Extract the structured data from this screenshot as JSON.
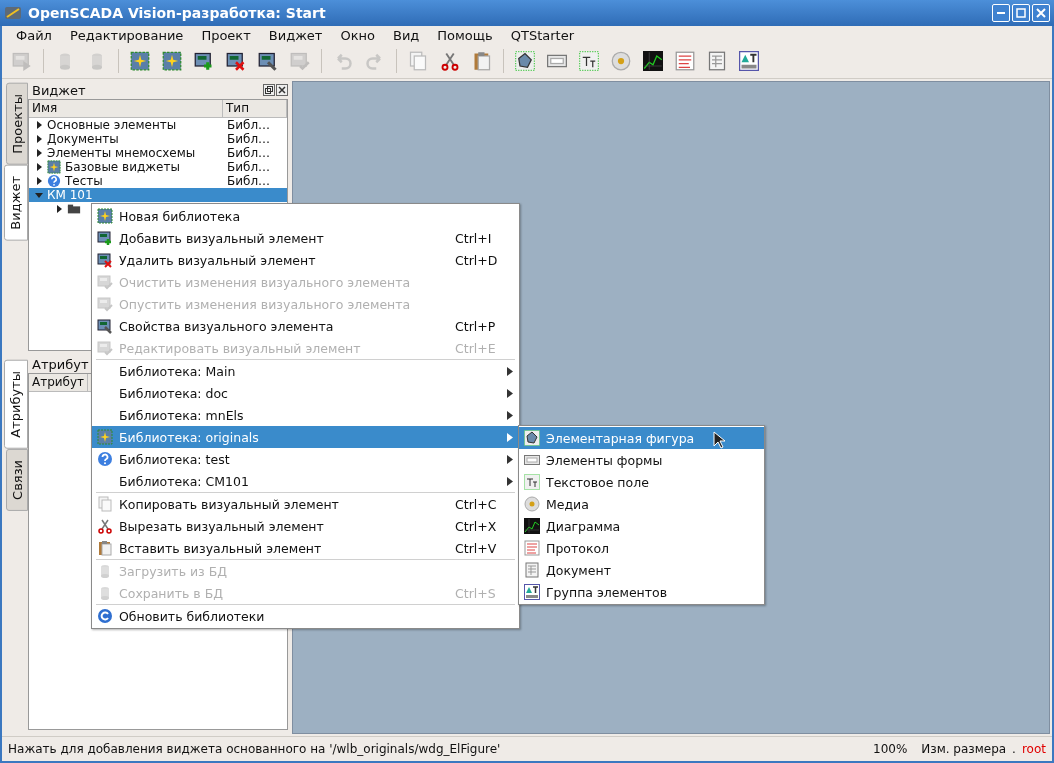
{
  "window": {
    "title": "OpenSCADA Vision-разработка: Start"
  },
  "menu_bar": [
    {
      "label": "Файл"
    },
    {
      "label": "Редактирование"
    },
    {
      "label": "Проект"
    },
    {
      "label": "Виджет"
    },
    {
      "label": "Окно"
    },
    {
      "label": "Вид"
    },
    {
      "label": "Помощь"
    },
    {
      "label": "QTStarter"
    }
  ],
  "toolbar": [
    {
      "kind": "run",
      "disabled": true
    },
    {
      "kind": "separator"
    },
    {
      "kind": "db-load",
      "disabled": true
    },
    {
      "kind": "db-save",
      "disabled": true
    },
    {
      "kind": "separator"
    },
    {
      "kind": "lib",
      "disabled": false
    },
    {
      "kind": "lib-new",
      "disabled": false
    },
    {
      "kind": "add",
      "disabled": false
    },
    {
      "kind": "delete",
      "disabled": false
    },
    {
      "kind": "props",
      "disabled": false
    },
    {
      "kind": "edit",
      "disabled": true
    },
    {
      "kind": "separator"
    },
    {
      "kind": "undo",
      "disabled": true
    },
    {
      "kind": "redo",
      "disabled": true
    },
    {
      "kind": "separator"
    },
    {
      "kind": "copy",
      "disabled": false
    },
    {
      "kind": "cut",
      "disabled": false
    },
    {
      "kind": "paste",
      "disabled": false
    },
    {
      "kind": "separator"
    },
    {
      "kind": "figure",
      "disabled": false
    },
    {
      "kind": "form",
      "disabled": false
    },
    {
      "kind": "text",
      "disabled": false
    },
    {
      "kind": "media",
      "disabled": false
    },
    {
      "kind": "diagram",
      "disabled": false
    },
    {
      "kind": "protocol",
      "disabled": false
    },
    {
      "kind": "document",
      "disabled": false
    },
    {
      "kind": "group",
      "disabled": false
    }
  ],
  "side_tabs_top": [
    {
      "label": "Проекты",
      "selected": false
    },
    {
      "label": "Виджет",
      "selected": true
    }
  ],
  "side_tabs_bottom": [
    {
      "label": "Атрибуты",
      "selected": true
    },
    {
      "label": "Связи",
      "selected": false
    }
  ],
  "widget_dock": {
    "title": "Виджет",
    "columns": [
      "Имя",
      "Тип"
    ],
    "tree": [
      {
        "kind": "plain",
        "name": "Основные элементы",
        "type": "Библ…",
        "expanded": false,
        "selected": false
      },
      {
        "kind": "plain",
        "name": "Документы",
        "type": "Библ…",
        "expanded": false,
        "selected": false
      },
      {
        "kind": "plain",
        "name": "Элементы мнемосхемы",
        "type": "Библ…",
        "expanded": false,
        "selected": false
      },
      {
        "kind": "lib",
        "name": "Базовые виджеты",
        "type": "Библ…",
        "expanded": false,
        "selected": false
      },
      {
        "kind": "question",
        "name": "Тесты",
        "type": "Библ…",
        "expanded": false,
        "selected": false
      },
      {
        "kind": "plain",
        "name": "КМ 101",
        "expanded": true,
        "selected": true,
        "children": [
          {
            "kind": "folder",
            "expanded": false,
            "selected": false
          }
        ]
      }
    ]
  },
  "attributes_dock": {
    "title": "Атрибут",
    "columns": [
      "Атрибут"
    ]
  },
  "context_menu": [
    {
      "kind": "lib-new",
      "label": "Новая библиотека",
      "submenu": false,
      "disabled": false,
      "selected": false
    },
    {
      "kind": "add",
      "label": "Добавить визуальный элемент",
      "shortcut": "Ctrl+I",
      "submenu": false,
      "disabled": false,
      "selected": false
    },
    {
      "kind": "delete",
      "label": "Удалить визуальный элемент",
      "shortcut": "Ctrl+D",
      "submenu": false,
      "disabled": false,
      "selected": false
    },
    {
      "kind": "clear",
      "label": "Очистить изменения визуального элемента",
      "submenu": false,
      "disabled": true,
      "selected": false
    },
    {
      "kind": "revert",
      "label": "Опустить изменения визуального элемента",
      "submenu": false,
      "disabled": true,
      "selected": false
    },
    {
      "kind": "props",
      "label": "Свойства визуального элемента",
      "shortcut": "Ctrl+P",
      "submenu": false,
      "disabled": false,
      "selected": false
    },
    {
      "kind": "edit",
      "label": "Редактировать визуальный элемент",
      "shortcut": "Ctrl+E",
      "submenu": false,
      "disabled": true,
      "selected": false
    },
    {
      "kind": "separator"
    },
    {
      "kind": "plain",
      "label": "Библиотека: Main",
      "submenu": true,
      "disabled": false,
      "selected": false
    },
    {
      "kind": "plain",
      "label": "Библиотека: doc",
      "submenu": true,
      "disabled": false,
      "selected": false
    },
    {
      "kind": "plain",
      "label": "Библиотека: mnEls",
      "submenu": true,
      "disabled": false,
      "selected": false
    },
    {
      "kind": "lib",
      "label": "Библиотека: originals",
      "submenu": true,
      "disabled": false,
      "selected": true
    },
    {
      "kind": "question",
      "label": "Библиотека: test",
      "submenu": true,
      "disabled": false,
      "selected": false
    },
    {
      "kind": "plain",
      "label": "Библиотека: CM101",
      "submenu": true,
      "disabled": false,
      "selected": false
    },
    {
      "kind": "separator"
    },
    {
      "kind": "copy",
      "label": "Копировать визуальный элемент",
      "shortcut": "Ctrl+C",
      "submenu": false,
      "disabled": false,
      "selected": false
    },
    {
      "kind": "cut",
      "label": "Вырезать визуальный элемент",
      "shortcut": "Ctrl+X",
      "submenu": false,
      "disabled": false,
      "selected": false
    },
    {
      "kind": "paste",
      "label": "Вставить визуальный элемент",
      "shortcut": "Ctrl+V",
      "submenu": false,
      "disabled": false,
      "selected": false
    },
    {
      "kind": "separator"
    },
    {
      "kind": "db-load",
      "label": "Загрузить из БД",
      "submenu": false,
      "disabled": true,
      "selected": false
    },
    {
      "kind": "db-save",
      "label": "Сохранить в БД",
      "shortcut": "Ctrl+S",
      "submenu": false,
      "disabled": true,
      "selected": false
    },
    {
      "kind": "separator"
    },
    {
      "kind": "refresh",
      "label": "Обновить библиотеки",
      "submenu": false,
      "disabled": false,
      "selected": false
    }
  ],
  "submenu": [
    {
      "kind": "figure",
      "label": "Элементарная фигура",
      "selected": true
    },
    {
      "kind": "form",
      "label": "Элементы формы",
      "selected": false
    },
    {
      "kind": "text",
      "label": "Текстовое поле",
      "selected": false
    },
    {
      "kind": "media",
      "label": "Медиа",
      "selected": false
    },
    {
      "kind": "diagram",
      "label": "Диаграмма",
      "selected": false
    },
    {
      "kind": "protocol",
      "label": "Протокол",
      "selected": false
    },
    {
      "kind": "document",
      "label": "Документ",
      "selected": false
    },
    {
      "kind": "group",
      "label": "Группа элементов",
      "selected": false
    }
  ],
  "status_bar": {
    "message": "Нажать для добавления виджета основанного на '/wlb_originals/wdg_ElFigure'",
    "zoom": "100%",
    "mode": "Изм. размера",
    "marker": ".",
    "user": "root"
  }
}
